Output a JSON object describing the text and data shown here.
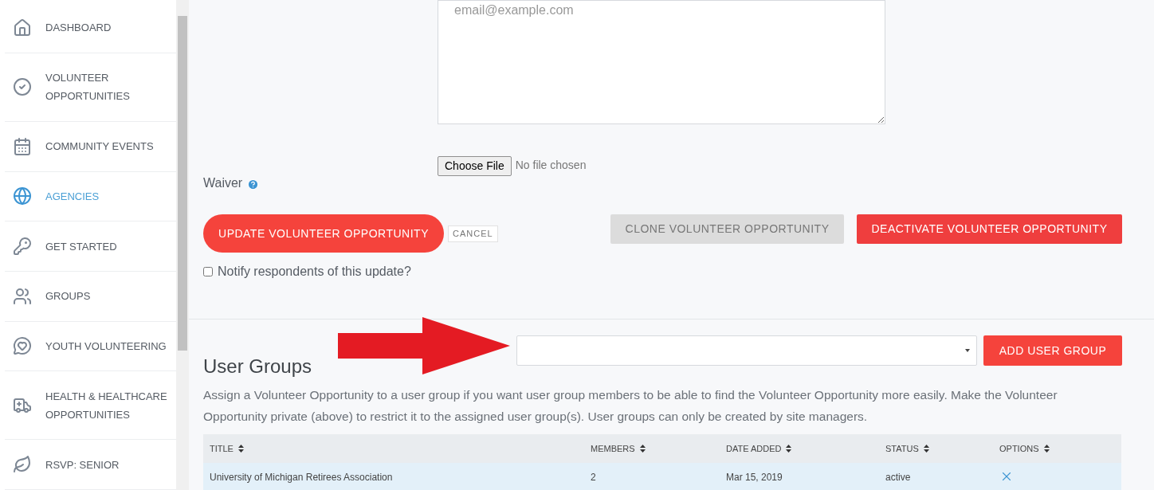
{
  "sidebar": {
    "items": [
      {
        "kind": "home",
        "label": "DASHBOARD",
        "selected": false
      },
      {
        "kind": "check",
        "label": "VOLUNTEER OPPORTUNITIES",
        "selected": false
      },
      {
        "kind": "calendar",
        "label": "COMMUNITY EVENTS",
        "selected": false
      },
      {
        "kind": "globe",
        "label": "AGENCIES",
        "selected": true
      },
      {
        "kind": "key",
        "label": "GET STARTED",
        "selected": false
      },
      {
        "kind": "people",
        "label": "GROUPS",
        "selected": false
      },
      {
        "kind": "heart",
        "label": "YOUTH VOLUNTEERING",
        "selected": false
      },
      {
        "kind": "ambulance",
        "label": "HEALTH & HEALTHCARE OPPORTUNITIES",
        "selected": false
      },
      {
        "kind": "leaf",
        "label": "RSVP: SENIOR",
        "selected": false
      }
    ]
  },
  "form": {
    "email_field": {
      "placeholder": "email@example.com"
    },
    "waiver": {
      "label": "Waiver",
      "choose_button": "Choose File",
      "file_status": "No file chosen"
    },
    "update_button": "UPDATE VOLUNTEER OPPORTUNITY",
    "cancel_button": "CANCEL",
    "clone_button": "CLONE VOLUNTEER OPPORTUNITY",
    "deactivate_button": "DEACTIVATE VOLUNTEER OPPORTUNITY",
    "notify": {
      "label": "Notify respondents of this update?",
      "checked": false
    }
  },
  "user_groups": {
    "title": "User Groups",
    "add_button": "ADD USER GROUP",
    "description": "Assign a Volunteer Opportunity to a user group if you want user group members to be able to find the Volunteer Opportunity more easily. Make the Volunteer Opportunity private (above) to restrict it to the assigned user group(s). User groups can only be created by site managers.",
    "table": {
      "columns": [
        "TITLE",
        "MEMBERS",
        "DATE ADDED",
        "STATUS",
        "OPTIONS"
      ],
      "rows": [
        {
          "cells": [
            "University of Michigan Retirees Association",
            "2",
            "Mar 15, 2019",
            "active"
          ],
          "selected": true
        }
      ]
    }
  }
}
